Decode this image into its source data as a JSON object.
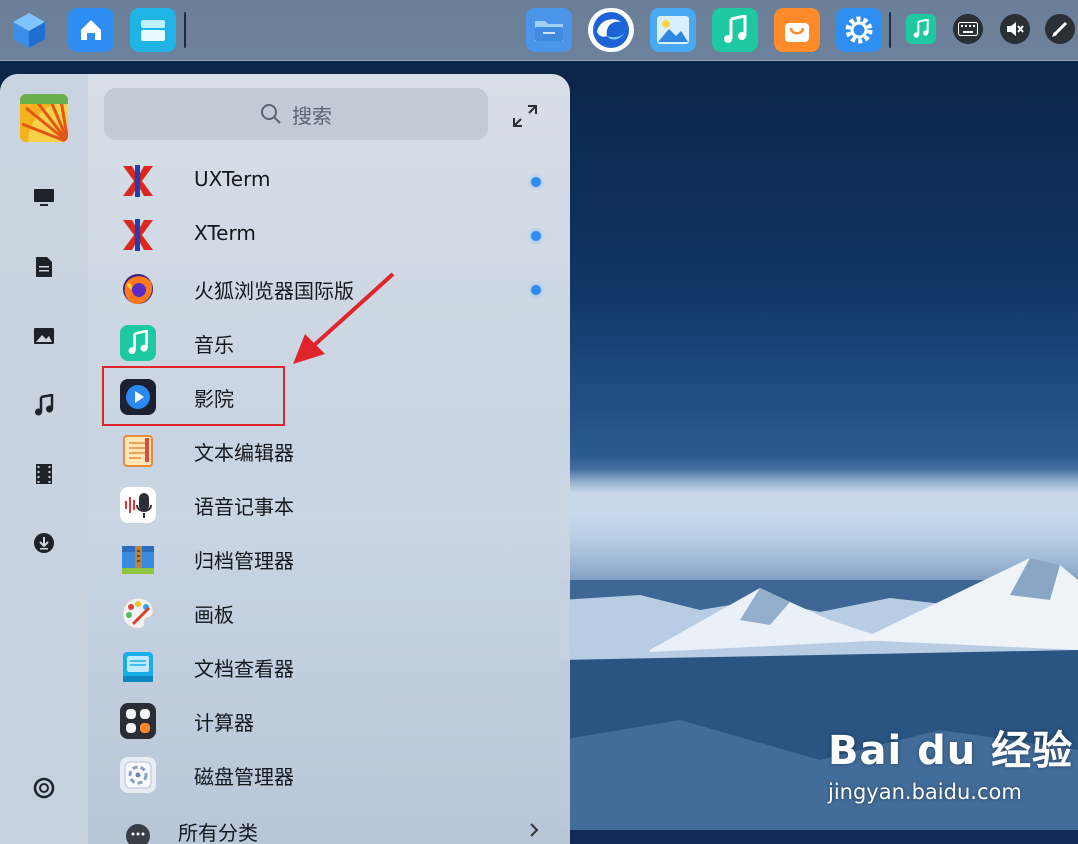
{
  "dock": {
    "apps": [
      {
        "name": "launcher",
        "icon": "cube-icon",
        "color": "#3b8ee6"
      },
      {
        "name": "home",
        "icon": "home-icon",
        "color": "#2d8df0"
      },
      {
        "name": "multitask",
        "icon": "windows-icon",
        "color": "#27b4e6"
      },
      {
        "name": "file-manager",
        "icon": "folder-icon",
        "color": "#3e8fea"
      },
      {
        "name": "browser",
        "icon": "browser-icon",
        "color": "#1a64d8"
      },
      {
        "name": "image-viewer",
        "icon": "image-icon",
        "color": "#3aa3f0"
      },
      {
        "name": "music",
        "icon": "music-icon",
        "color": "#1ec8a0"
      },
      {
        "name": "app-store",
        "icon": "store-icon",
        "color": "#ff8a2a"
      },
      {
        "name": "settings",
        "icon": "gear-icon",
        "color": "#2f8ff0"
      }
    ],
    "tray": [
      {
        "name": "music-tray",
        "icon": "music-icon"
      },
      {
        "name": "keyboard",
        "icon": "keyboard-icon"
      },
      {
        "name": "volume-muted",
        "icon": "speaker-muted-icon"
      },
      {
        "name": "pen",
        "icon": "pen-icon"
      }
    ]
  },
  "launcher": {
    "search_placeholder": "搜索",
    "sidebar": [
      {
        "name": "avatar",
        "icon": "avatar-icon"
      },
      {
        "name": "computer",
        "icon": "monitor-icon"
      },
      {
        "name": "documents",
        "icon": "document-icon"
      },
      {
        "name": "pictures",
        "icon": "picture-icon"
      },
      {
        "name": "music",
        "icon": "music-note-icon"
      },
      {
        "name": "videos",
        "icon": "film-icon"
      },
      {
        "name": "downloads",
        "icon": "download-icon"
      },
      {
        "name": "power",
        "icon": "power-icon"
      }
    ],
    "apps": [
      {
        "label": "UXTerm",
        "icon": "xterm-icon",
        "new": true
      },
      {
        "label": "XTerm",
        "icon": "xterm-icon",
        "new": true
      },
      {
        "label": "火狐浏览器国际版",
        "icon": "firefox-icon",
        "new": true
      },
      {
        "label": "音乐",
        "icon": "music-icon",
        "new": false
      },
      {
        "label": "影院",
        "icon": "movie-player-icon",
        "new": false
      },
      {
        "label": "文本编辑器",
        "icon": "text-editor-icon",
        "new": false
      },
      {
        "label": "语音记事本",
        "icon": "voice-note-icon",
        "new": false
      },
      {
        "label": "归档管理器",
        "icon": "archive-icon",
        "new": false
      },
      {
        "label": "画板",
        "icon": "palette-icon",
        "new": false
      },
      {
        "label": "文档查看器",
        "icon": "doc-viewer-icon",
        "new": false
      },
      {
        "label": "计算器",
        "icon": "calculator-icon",
        "new": false
      },
      {
        "label": "磁盘管理器",
        "icon": "disk-icon",
        "new": false
      },
      {
        "label": "所有分类",
        "icon": "more-icon",
        "new": false
      }
    ],
    "highlighted_app": "影院"
  },
  "watermark": {
    "logo": "Bai du 经验",
    "url": "jingyan.baidu.com"
  },
  "colors": {
    "highlight": "#e0242c",
    "new_dot": "#2f8cf0"
  }
}
